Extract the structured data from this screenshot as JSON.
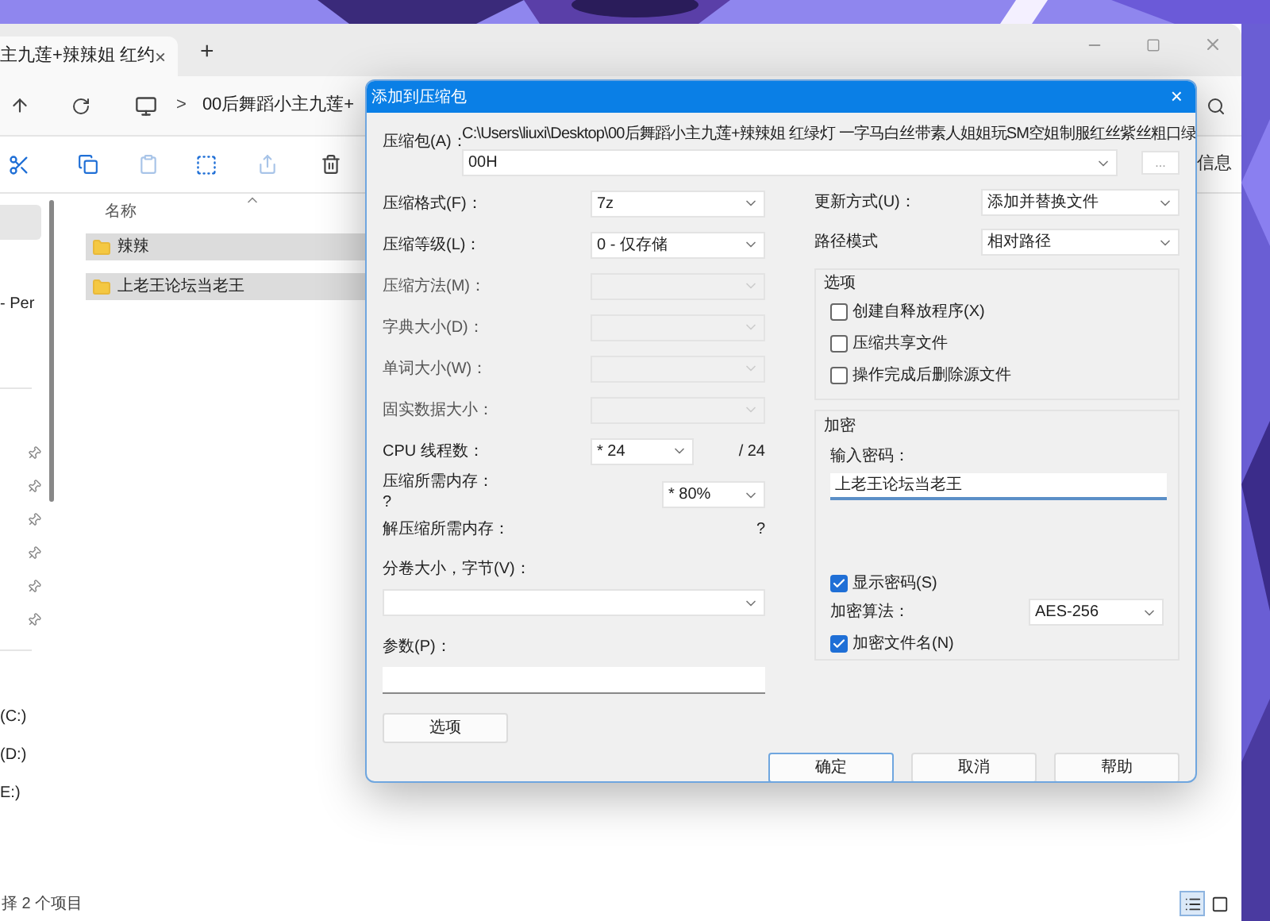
{
  "explorer": {
    "tab": {
      "title": "主九莲+辣辣姐 红约",
      "close": "×"
    },
    "new_tab": "+",
    "breadcrumb_sep": ">",
    "breadcrumb": "00后舞蹈小主九莲+",
    "toolbar_more": "信息",
    "column_header": "名称",
    "files": [
      {
        "name": "辣辣",
        "selected": true
      },
      {
        "name": "上老王论坛当老王",
        "selected": true
      }
    ],
    "sidebar_label": "- Per",
    "drives": [
      "(C:)",
      "(D:)",
      "E:)"
    ],
    "status": "择 2 个项目"
  },
  "dialog": {
    "title": "添加到压缩包",
    "close": "×",
    "archive": {
      "label": "压缩包(A)：",
      "path": "C:\\Users\\liuxi\\Desktop\\00后舞蹈小主九莲+辣辣姐 红绿灯 一字马白丝带素人姐姐玩SM空姐制服红丝紫丝粗口绿",
      "value": "00H",
      "browse": "..."
    },
    "left_fields": [
      {
        "label": "压缩格式(F)：",
        "value": "7z",
        "disabled": false
      },
      {
        "label": "压缩等级(L)：",
        "value": "0 - 仅存储",
        "disabled": false
      },
      {
        "label": "压缩方法(M)：",
        "disabled": true
      },
      {
        "label": "字典大小(D)：",
        "disabled": true
      },
      {
        "label": "单词大小(W)：",
        "disabled": true
      },
      {
        "label": "固实数据大小：",
        "disabled": true
      }
    ],
    "cpu": {
      "label": "CPU 线程数：",
      "value": "* 24",
      "max": "/ 24"
    },
    "memory": {
      "label": "压缩所需内存：",
      "value": "?",
      "percent": "* 80%"
    },
    "decompress": {
      "label": "解压缩所需内存：",
      "value": "?"
    },
    "volume": {
      "label": "分卷大小，字节(V)："
    },
    "params": {
      "label": "参数(P)："
    },
    "options_button": "选项",
    "update": {
      "label": "更新方式(U)：",
      "value": "添加并替换文件"
    },
    "path_mode": {
      "label": "路径模式",
      "value": "相对路径"
    },
    "options": {
      "title": "选项",
      "items": [
        {
          "label": "创建自释放程序(X)",
          "checked": false
        },
        {
          "label": "压缩共享文件",
          "checked": false
        },
        {
          "label": "操作完成后删除源文件",
          "checked": false
        }
      ]
    },
    "encryption": {
      "title": "加密",
      "password_label": "输入密码：",
      "password": "上老王论坛当老王",
      "show_password": {
        "label": "显示密码(S)",
        "checked": true
      },
      "method": {
        "label": "加密算法：",
        "value": "AES-256"
      },
      "encrypt_names": {
        "label": "加密文件名(N)",
        "checked": true
      }
    },
    "buttons": [
      {
        "label": "确定",
        "default": true
      },
      {
        "label": "取消",
        "default": false
      },
      {
        "label": "帮助",
        "default": false
      }
    ]
  }
}
